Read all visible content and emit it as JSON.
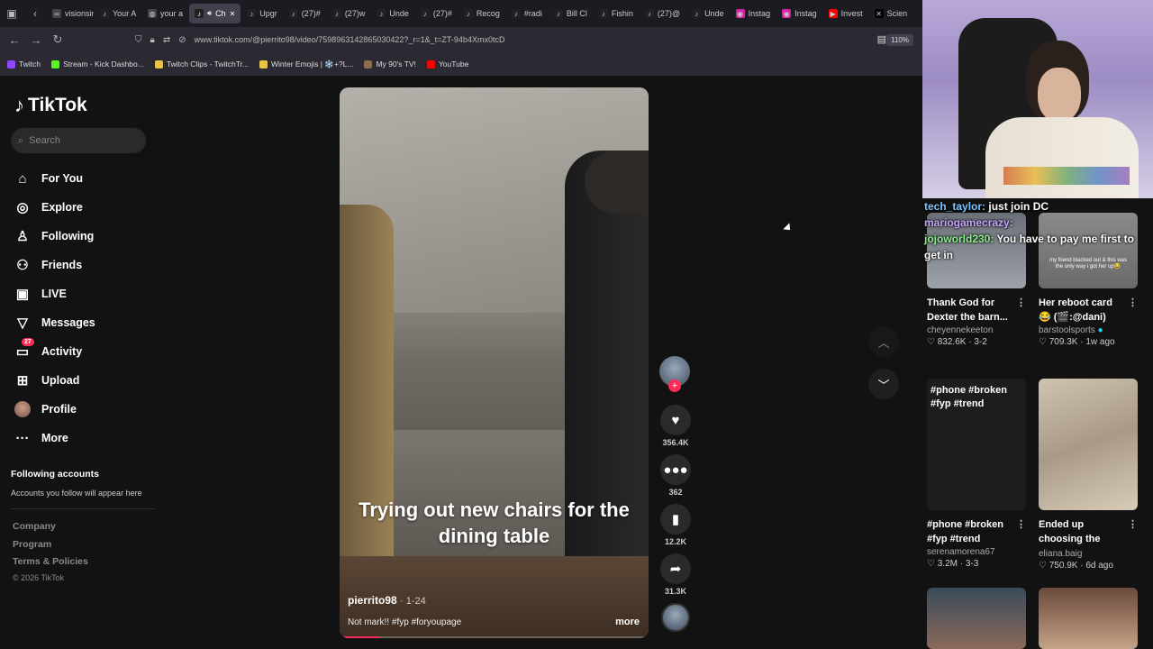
{
  "browser": {
    "tabs": [
      {
        "label": "visionsim",
        "icon": "link-icon"
      },
      {
        "label": "Your A",
        "icon": "tiktok-icon"
      },
      {
        "label": "your a",
        "icon": "globe-icon"
      },
      {
        "label": "Ch",
        "icon": "tiktok-icon",
        "active": true
      },
      {
        "label": "Upgr",
        "icon": "tiktok-icon"
      },
      {
        "label": "(27)#",
        "icon": "tiktok-icon"
      },
      {
        "label": "(27)w",
        "icon": "tiktok-icon"
      },
      {
        "label": "Unde",
        "icon": "tiktok-icon"
      },
      {
        "label": "(27)#",
        "icon": "tiktok-icon"
      },
      {
        "label": "Recog",
        "icon": "tiktok-icon"
      },
      {
        "label": "#radi",
        "icon": "tiktok-icon"
      },
      {
        "label": "Bill Cl",
        "icon": "tiktok-icon"
      },
      {
        "label": "Fishin",
        "icon": "tiktok-icon"
      },
      {
        "label": "(27)@",
        "icon": "tiktok-icon"
      },
      {
        "label": "Unde",
        "icon": "tiktok-icon"
      },
      {
        "label": "Instag",
        "icon": "instagram-icon"
      },
      {
        "label": "Instag",
        "icon": "instagram-icon"
      },
      {
        "label": "Invest",
        "icon": "youtube-icon"
      },
      {
        "label": "Scien",
        "icon": "x-icon"
      }
    ],
    "url": "www.tiktok.com/@pierrito98/video/7598963142865030422?_r=1&_t=ZT-94b4Xmx0tcD",
    "zoom": "110%",
    "bookmarks": [
      {
        "label": "Twitch",
        "color": "#9146ff"
      },
      {
        "label": "Stream - Kick Dashbo...",
        "color": "#53fc18"
      },
      {
        "label": "Twitch Clips - TwitchTr...",
        "color": "#e8c547"
      },
      {
        "label": "Winter Emojis | ❄️+?L...",
        "color": "#e8c547"
      },
      {
        "label": "My 90's TV!",
        "color": "#8a6d4f"
      },
      {
        "label": "YouTube",
        "color": "#ff0000"
      }
    ]
  },
  "sidebar": {
    "logo": "TikTok",
    "search_placeholder": "Search",
    "items": [
      {
        "label": "For You",
        "icon": "home-icon"
      },
      {
        "label": "Explore",
        "icon": "compass-icon"
      },
      {
        "label": "Following",
        "icon": "following-icon"
      },
      {
        "label": "Friends",
        "icon": "friends-icon"
      },
      {
        "label": "LIVE",
        "icon": "live-icon"
      },
      {
        "label": "Messages",
        "icon": "messages-icon"
      },
      {
        "label": "Activity",
        "icon": "activity-icon",
        "badge": "27"
      },
      {
        "label": "Upload",
        "icon": "upload-icon"
      },
      {
        "label": "Profile",
        "icon": "avatar"
      },
      {
        "label": "More",
        "icon": "more-icon"
      }
    ],
    "following_heading": "Following accounts",
    "following_text": "Accounts you follow will appear here",
    "footer": [
      "Company",
      "Program",
      "Terms & Policies",
      "© 2026 TikTok"
    ]
  },
  "video": {
    "caption": "Trying out new chairs for the dining table",
    "author": "pierrito98",
    "date": "· 1-24",
    "description": "Not mark!! #fyp #foryoupage",
    "more": "more",
    "progress": 0.13,
    "likes": "356.4K",
    "comments": "362",
    "saves": "12.2K",
    "shares": "31.3K"
  },
  "overlay_chat": [
    {
      "user": "tech_taylor:",
      "text": "just join DC",
      "color": "#7cc4ff"
    },
    {
      "user": "mariogamecrazy:",
      "text": "",
      "color": "#c9a4ff"
    },
    {
      "user": "jojoworld230:",
      "text": "You have to pay me first to get in",
      "color": "#8cf08c"
    }
  ],
  "grid": [
    {
      "title": "Thank God for Dexter the barn...",
      "author": "cheyennekeeton",
      "likes": "832.6K",
      "date": "3-2"
    },
    {
      "title": "Her reboot card 😂 (🎬:@dani)",
      "author": "barstoolsports",
      "likes": "709.3K",
      "date": "1w ago",
      "thumb_text": "my friend blacked out & this was the only way i got her up😂"
    },
    {
      "title": "#phone #broken #fyp #trend",
      "author": "serenamorena67",
      "likes": "3.2M",
      "date": "3-3",
      "thumb_text": "#phone #broken #fyp #trend"
    },
    {
      "title": "Ended up choosing the roo...",
      "author": "eliana.baig",
      "likes": "750.9K",
      "date": "6d ago"
    }
  ]
}
